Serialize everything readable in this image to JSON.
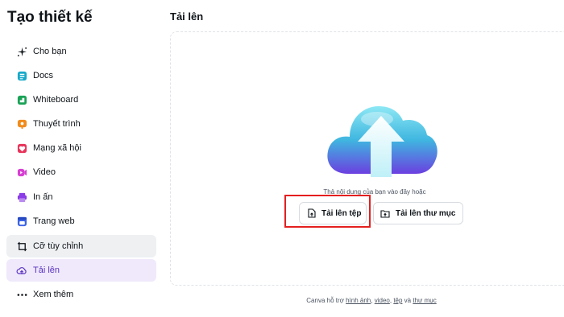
{
  "app": {
    "title": "Tạo thiết kế"
  },
  "sidebar": {
    "items": [
      {
        "label": "Cho bạn",
        "icon": "sparkle-icon"
      },
      {
        "label": "Docs",
        "icon": "docs-icon",
        "color": "#17a9c9"
      },
      {
        "label": "Whiteboard",
        "icon": "whiteboard-icon",
        "color": "#1aa257"
      },
      {
        "label": "Thuyết trình",
        "icon": "presentation-icon",
        "color": "#f08b1c"
      },
      {
        "label": "Mạng xã hội",
        "icon": "heart-icon",
        "color": "#e8345a"
      },
      {
        "label": "Video",
        "icon": "video-icon",
        "color": "#d63fd2"
      },
      {
        "label": "In ấn",
        "icon": "printer-icon",
        "color": "#8a3ce6"
      },
      {
        "label": "Trang web",
        "icon": "web-icon",
        "color": "#3c64e6"
      },
      {
        "label": "Cỡ tùy chỉnh",
        "icon": "crop-icon"
      },
      {
        "label": "Tải lên",
        "icon": "cloud-upload-icon"
      },
      {
        "label": "Xem thêm",
        "icon": "more-icon"
      }
    ],
    "active_index": 9,
    "hovered_index": 8
  },
  "main": {
    "title": "Tải lên",
    "drop_hint": "Thả nội dung của bạn vào đây hoặc",
    "upload_file_label": "Tải lên tệp",
    "upload_folder_label": "Tải lên thư mục"
  },
  "footer": {
    "prefix": "Canva hỗ trợ",
    "link_images": "hình ảnh",
    "sep1": ",",
    "link_video": "video",
    "sep2": ",",
    "link_files": "tệp",
    "and": "và",
    "link_folders": "thư mục"
  },
  "colors": {
    "accent": "#5a32c0",
    "active_bg": "#efe9fb",
    "highlight": "#e41f1f"
  }
}
